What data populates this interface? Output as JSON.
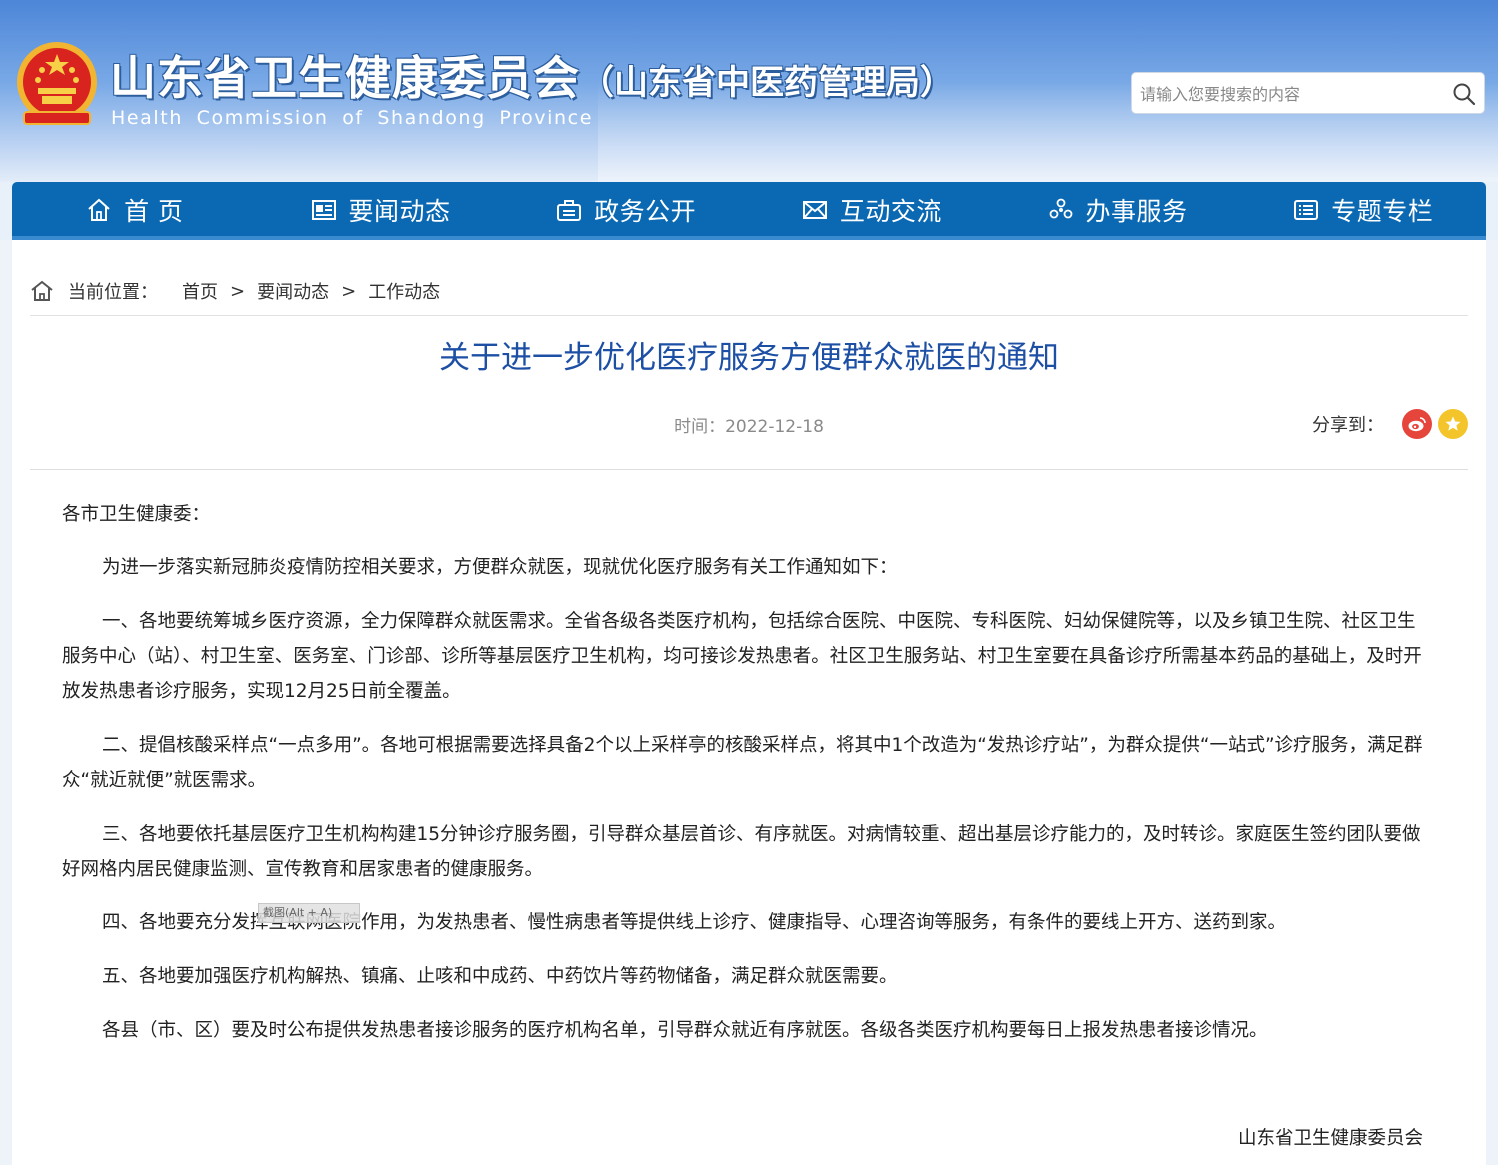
{
  "header": {
    "site_title": "山东省卫生健康委员会",
    "site_subtitle": "（山东省中医药管理局）",
    "site_english": "Health Commission of Shandong Province",
    "search_placeholder": "请输入您要搜索的内容"
  },
  "nav": {
    "items": [
      {
        "label": "首 页",
        "icon": "home-icon"
      },
      {
        "label": "要闻动态",
        "icon": "news-icon"
      },
      {
        "label": "政务公开",
        "icon": "briefcase-icon"
      },
      {
        "label": "互动交流",
        "icon": "mail-icon"
      },
      {
        "label": "办事服务",
        "icon": "service-icon"
      },
      {
        "label": "专题专栏",
        "icon": "column-icon"
      }
    ]
  },
  "breadcrumb": {
    "label": "当前位置：",
    "items": [
      "首页",
      "要闻动态",
      "工作动态"
    ],
    "separator": ">"
  },
  "article": {
    "title": "关于进一步优化医疗服务方便群众就医的通知",
    "time": "时间：2022-12-18",
    "share_label": "分享到：",
    "salutation": "各市卫生健康委：",
    "paragraphs": [
      "为进一步落实新冠肺炎疫情防控相关要求，方便群众就医，现就优化医疗服务有关工作通知如下：",
      "一、各地要统筹城乡医疗资源，全力保障群众就医需求。全省各级各类医疗机构，包括综合医院、中医院、专科医院、妇幼保健院等，以及乡镇卫生院、社区卫生服务中心（站）、村卫生室、医务室、门诊部、诊所等基层医疗卫生机构，均可接诊发热患者。社区卫生服务站、村卫生室要在具备诊疗所需基本药品的基础上，及时开放发热患者诊疗服务，实现12月25日前全覆盖。",
      "二、提倡核酸采样点“一点多用”。各地可根据需要选择具备2个以上采样亭的核酸采样点，将其中1个改造为“发热诊疗站”，为群众提供“一站式”诊疗服务，满足群众“就近就便”就医需求。",
      "三、各地要依托基层医疗卫生机构构建15分钟诊疗服务圈，引导群众基层首诊、有序就医。对病情较重、超出基层诊疗能力的，及时转诊。家庭医生签约团队要做好网格内居民健康监测、宣传教育和居家患者的健康服务。",
      "四、各地要充分发挥互联网医院作用，为发热患者、慢性病患者等提供线上诊疗、健康指导、心理咨询等服务，有条件的要线上开方、送药到家。",
      "五、各地要加强医疗机构解热、镇痛、止咳和中成药、中药饮片等药物储备，满足群众就医需要。",
      "各县（市、区）要及时公布提供发热患者接诊服务的医疗机构名单，引导群众就近有序就医。各级各类医疗机构要每日上报发热患者接诊情况。"
    ],
    "signature": "山东省卫生健康委员会"
  },
  "overlay": {
    "screenshot_tag": "截图(Alt + A)"
  },
  "colors": {
    "nav_blue": "#0b69b3",
    "title_blue": "#1d4fa5",
    "weibo_red": "#e6453b",
    "fav_yellow": "#f4c52b"
  }
}
